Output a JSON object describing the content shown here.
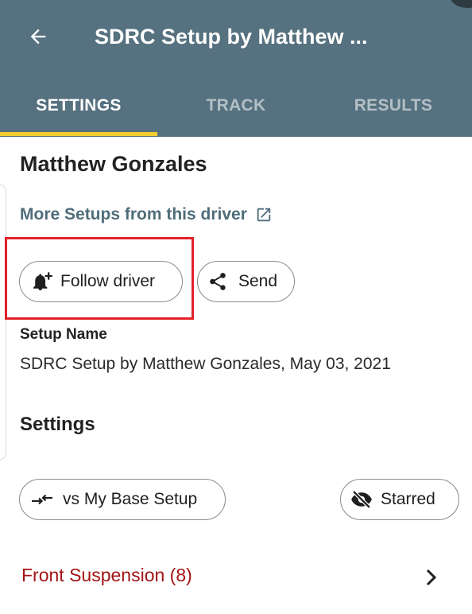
{
  "header": {
    "title": "SDRC Setup by Matthew ...",
    "back_icon": "arrow-left-icon",
    "background_color": "#56717f"
  },
  "tabs": [
    {
      "label": "SETTINGS",
      "active": true
    },
    {
      "label": "TRACK",
      "active": false
    },
    {
      "label": "RESULTS",
      "active": false
    }
  ],
  "tab_indicator_color": "#f2ce2e",
  "driver": {
    "name": "Matthew Gonzales",
    "more_setups_link": "More Setups from this driver",
    "link_icon": "open-external-icon"
  },
  "actions": {
    "follow_label": "Follow driver",
    "follow_icon": "bell-plus-icon",
    "send_label": "Send",
    "send_icon": "share-icon"
  },
  "setup": {
    "label": "Setup Name",
    "value": "SDRC Setup by Matthew Gonzales, May 03, 2021"
  },
  "settings": {
    "heading": "Settings",
    "compare_label": "vs My Base Setup",
    "compare_icon": "compare-arrows-icon",
    "starred_label": "Starred",
    "starred_icon": "eye-off-icon"
  },
  "sections": [
    {
      "label": "Front Suspension (8)",
      "color": "#a31414"
    }
  ],
  "highlight_color": "#e32128"
}
